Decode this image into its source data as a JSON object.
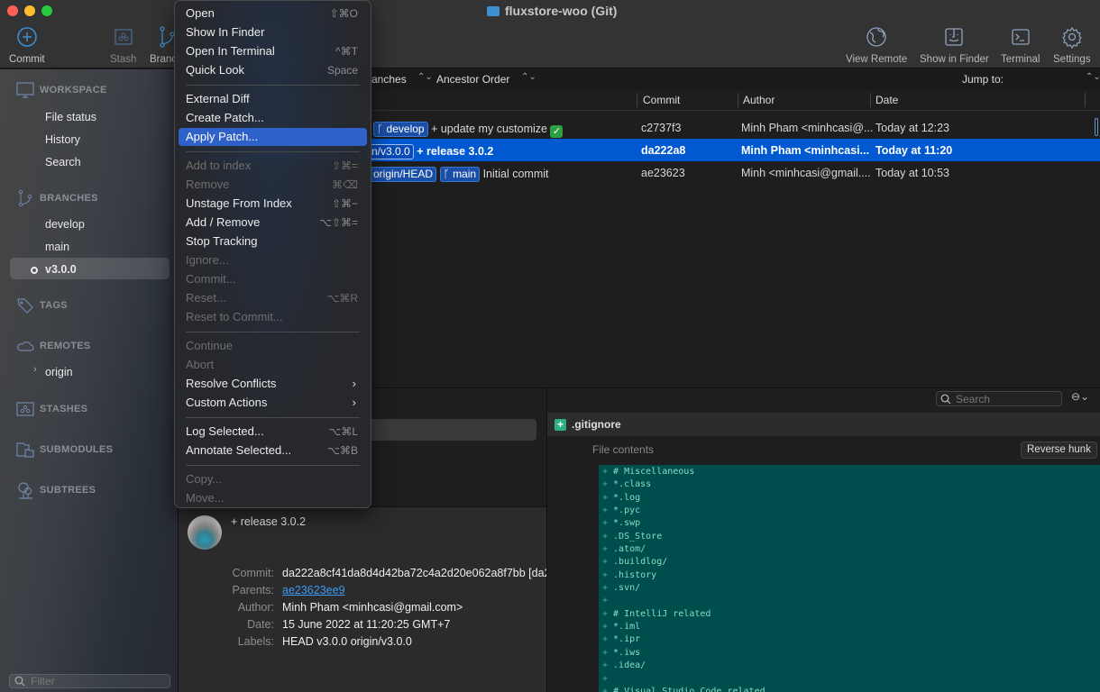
{
  "window": {
    "title": "fluxstore-woo (Git)",
    "traffic_lights": {
      "close": "#ff5f57",
      "minimize": "#febc2e",
      "zoom": "#28c840"
    }
  },
  "toolbar": {
    "left": [
      {
        "label": "Commit",
        "icon": "plus-circle-icon"
      },
      {
        "label": "Stash",
        "icon": "stash-icon"
      },
      {
        "label": "Branch",
        "icon": "branch-icon"
      }
    ],
    "right": [
      {
        "label": "View Remote",
        "icon": "globe-icon"
      },
      {
        "label": "Show in Finder",
        "icon": "finder-icon"
      },
      {
        "label": "Terminal",
        "icon": "terminal-icon"
      },
      {
        "label": "Settings",
        "icon": "gear-icon"
      }
    ]
  },
  "sidebar": {
    "workspace": {
      "label": "WORKSPACE",
      "items": [
        "File status",
        "History",
        "Search"
      ]
    },
    "branches": {
      "label": "BRANCHES",
      "items": [
        "develop",
        "main",
        "v3.0.0"
      ],
      "current": "v3.0.0"
    },
    "tags": {
      "label": "TAGS"
    },
    "remotes": {
      "label": "REMOTES",
      "items": [
        "origin"
      ]
    },
    "stashes": {
      "label": "STASHES"
    },
    "submodules": {
      "label": "SUBMODULES"
    },
    "subtrees": {
      "label": "SUBTREES"
    },
    "filter_placeholder": "Filter"
  },
  "log": {
    "branches_filter": "All Branches",
    "branches_filter_visible": "anches",
    "order": "Ancestor Order",
    "jump_to": "Jump to:",
    "columns": {
      "commit": "Commit",
      "author": "Author",
      "date": "Date"
    },
    "rows": [
      {
        "labels": [
          "develop"
        ],
        "message": "+ update my customize",
        "emoji": "✅",
        "commit": "c2737f3",
        "author": "Minh Pham <minhcasi@...",
        "date": "Today at 12:23"
      },
      {
        "labels": [
          "n/v3.0.0"
        ],
        "message": "+ release 3.0.2",
        "commit": "da222a8",
        "author": "Minh Pham <minhcasi...",
        "date": "Today at 11:20",
        "selected": true
      },
      {
        "labels": [
          "origin/HEAD",
          "main"
        ],
        "message": "Initial commit",
        "commit": "ae23623",
        "author": "Minh <minhcasi@gmail....",
        "date": "Today at 10:53"
      }
    ]
  },
  "context_menu": {
    "items": [
      {
        "label": "Open",
        "shortcut": "⇧⌘O",
        "enabled": true
      },
      {
        "label": "Show In Finder",
        "enabled": true
      },
      {
        "label": "Open In Terminal",
        "shortcut": "^⌘T",
        "enabled": true
      },
      {
        "label": "Quick Look",
        "shortcut": "Space",
        "enabled": true
      },
      {
        "separator": true
      },
      {
        "label": "External Diff",
        "enabled": true
      },
      {
        "label": "Create Patch...",
        "enabled": true
      },
      {
        "label": "Apply Patch...",
        "enabled": true,
        "highlighted": true
      },
      {
        "separator": true
      },
      {
        "label": "Add to index",
        "shortcut": "⇧⌘=",
        "enabled": false
      },
      {
        "label": "Remove",
        "shortcut": "⌘⌫",
        "enabled": false
      },
      {
        "label": "Unstage From Index",
        "shortcut": "⇧⌘−",
        "enabled": true
      },
      {
        "label": "Add / Remove",
        "shortcut": "⌥⇧⌘=",
        "enabled": true
      },
      {
        "label": "Stop Tracking",
        "enabled": true
      },
      {
        "label": "Ignore...",
        "enabled": false
      },
      {
        "label": "Commit...",
        "enabled": false
      },
      {
        "label": "Reset...",
        "shortcut": "⌥⌘R",
        "enabled": false
      },
      {
        "label": "Reset to Commit...",
        "enabled": false
      },
      {
        "separator": true
      },
      {
        "label": "Continue",
        "enabled": false
      },
      {
        "label": "Abort",
        "enabled": false
      },
      {
        "label": "Resolve Conflicts",
        "submenu": true,
        "enabled": true
      },
      {
        "label": "Custom Actions",
        "submenu": true,
        "enabled": true
      },
      {
        "separator": true
      },
      {
        "label": "Log Selected...",
        "shortcut": "⌥⌘L",
        "enabled": true
      },
      {
        "label": "Annotate Selected...",
        "shortcut": "⌥⌘B",
        "enabled": true
      },
      {
        "separator": true
      },
      {
        "label": "Copy...",
        "enabled": false
      },
      {
        "label": "Move...",
        "enabled": false
      }
    ]
  },
  "commit_detail": {
    "message": "+ release 3.0.2",
    "fields": [
      {
        "key": "Commit:",
        "value": "da222a8cf41da8d4d42ba72c4a2d20e062a8f7bb [da2"
      },
      {
        "key": "Parents:",
        "value": "ae23623ee9",
        "link": true
      },
      {
        "key": "Author:",
        "value": "Minh Pham <minhcasi@gmail.com>"
      },
      {
        "key": "Date:",
        "value": "15 June 2022 at 11:20:25 GMT+7"
      },
      {
        "key": "Labels:",
        "value": "HEAD v3.0.0 origin/v3.0.0"
      }
    ]
  },
  "diff": {
    "search_placeholder": "Search",
    "file_name": ".gitignore",
    "hunk_label": "File contents",
    "reverse_hunk_button": "Reverse hunk",
    "lines": [
      "# Miscellaneous",
      "*.class",
      "*.log",
      "*.pyc",
      "*.swp",
      ".DS_Store",
      ".atom/",
      ".buildlog/",
      ".history",
      ".svn/",
      "",
      "# IntelliJ related",
      "*.iml",
      "*.ipr",
      "*.iws",
      ".idea/",
      "",
      "# Visual Studio Code related"
    ]
  }
}
